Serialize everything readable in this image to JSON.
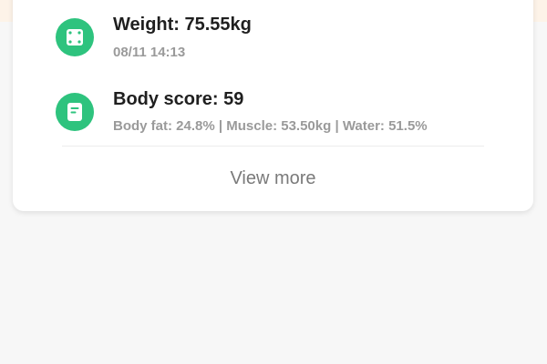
{
  "records": [
    {
      "icon": "scale-icon",
      "title": "Weight: 75.55kg",
      "subtitle": "08/11 14:13"
    },
    {
      "icon": "document-icon",
      "title": "Body score: 59",
      "subtitle": "Body fat: 24.8% | Muscle: 53.50kg | Water: 51.5%"
    }
  ],
  "footer": {
    "view_more_label": "View more"
  },
  "colors": {
    "accent": "#2ec37e",
    "title_text": "#1f1f1f",
    "subtitle_text": "#9a9a9a",
    "link_text": "#7a7a7a",
    "top_strip": "#fdf3e8",
    "background": "#f7f7f7"
  }
}
